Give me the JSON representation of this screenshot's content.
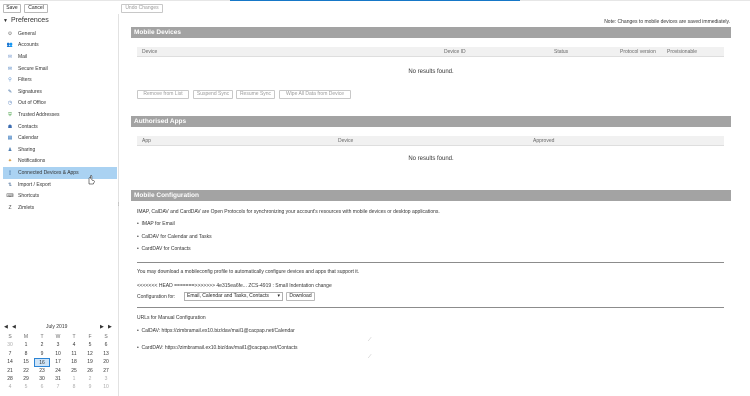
{
  "toolbar": {
    "save": "Save",
    "cancel": "Cancel",
    "undo": "Undo Changes"
  },
  "sidebar": {
    "title": "Preferences",
    "items": [
      {
        "label": "General",
        "icon": "gear-icon",
        "glyph": "⚙",
        "color": "#7a7a7a"
      },
      {
        "label": "Accounts",
        "icon": "accounts-icon",
        "glyph": "👥",
        "color": "#3b6fb0"
      },
      {
        "label": "Mail",
        "icon": "mail-icon",
        "glyph": "✉",
        "color": "#6b8fc8"
      },
      {
        "label": "Secure Email",
        "icon": "secure-email-icon",
        "glyph": "✉",
        "color": "#4a7fc0"
      },
      {
        "label": "Filters",
        "icon": "filters-icon",
        "glyph": "⚲",
        "color": "#5a8fcf"
      },
      {
        "label": "Signatures",
        "icon": "signature-icon",
        "glyph": "✎",
        "color": "#3a6aa0"
      },
      {
        "label": "Out of Office",
        "icon": "out-of-office-icon",
        "glyph": "◷",
        "color": "#4a78b8"
      },
      {
        "label": "Trusted Addresses",
        "icon": "shield-icon",
        "glyph": "⛨",
        "color": "#3a9a3a"
      },
      {
        "label": "Contacts",
        "icon": "contacts-icon",
        "glyph": "☗",
        "color": "#3c6cb0"
      },
      {
        "label": "Calendar",
        "icon": "calendar-icon",
        "glyph": "▦",
        "color": "#3c7cc0"
      },
      {
        "label": "Sharing",
        "icon": "sharing-icon",
        "glyph": "♟",
        "color": "#4c7cb0"
      },
      {
        "label": "Notifications",
        "icon": "notifications-icon",
        "glyph": "✦",
        "color": "#d08a20"
      },
      {
        "label": "Connected Devices & Apps",
        "icon": "devices-icon",
        "glyph": "▯",
        "color": "#3a6aa0",
        "selected": true
      },
      {
        "label": "Import / Export",
        "icon": "import-export-icon",
        "glyph": "⇅",
        "color": "#5a7aa0"
      },
      {
        "label": "Shortcuts",
        "icon": "shortcuts-icon",
        "glyph": "⌨",
        "color": "#555555"
      },
      {
        "label": "Zimlets",
        "icon": "zimlets-icon",
        "glyph": "Z",
        "color": "#444444"
      }
    ]
  },
  "calendar": {
    "prev": "◀",
    "prev_fast": "◀",
    "month": "July 2019",
    "next": "▶",
    "next_fast": "▶",
    "dow": [
      "S",
      "M",
      "T",
      "W",
      "T",
      "F",
      "S"
    ],
    "weeks": [
      [
        "30",
        "1",
        "2",
        "3",
        "4",
        "5",
        "6"
      ],
      [
        "7",
        "8",
        "9",
        "10",
        "11",
        "12",
        "13"
      ],
      [
        "14",
        "15",
        "16",
        "17",
        "18",
        "19",
        "20"
      ],
      [
        "21",
        "22",
        "23",
        "24",
        "25",
        "26",
        "27"
      ],
      [
        "28",
        "29",
        "30",
        "31",
        "1",
        "2",
        "3"
      ],
      [
        "4",
        "5",
        "6",
        "7",
        "8",
        "9",
        "10"
      ]
    ],
    "today": "16"
  },
  "main": {
    "note": "Note: Changes to mobile devices are saved immediately.",
    "mobile_devices": {
      "title": "Mobile Devices",
      "columns": [
        "Device",
        "Device ID",
        "Status",
        "Protocol version",
        "Provisionable"
      ],
      "empty": "No results found.",
      "buttons": [
        "Remove from List",
        "Suspend Sync",
        "Resume Sync",
        "Wipe All Data from Device"
      ]
    },
    "authorised_apps": {
      "title": "Authorised Apps",
      "columns": [
        "App",
        "Device",
        "Approved"
      ],
      "empty": "No results found."
    },
    "mobile_config": {
      "title": "Mobile Configuration",
      "intro": "IMAP, CalDAV and CardDAV are Open Protocols for synchronizing your account's resources with mobile devices or desktop applications.",
      "bullets": [
        "IMAP for Email",
        "CalDAV for Calendar and Tasks",
        "CardDAV for Contacts"
      ],
      "download_text": "You may download a mobileconfig profile to automatically configure devices and apps that support it.",
      "merge_text": "<<<<<<< HEAD =======>>>>>>> 4e315ea6fe... ZCS-4919 : Small Indentation change",
      "config_label": "Configuration for:",
      "config_value": "Email, Calendar and Tasks, Contacts",
      "download_button": "Download",
      "urls_title": "URLs for Manual Configuration",
      "caldav": "CalDAV: https://zimbramail.ex10.biz/dav/mail1@cacpap.net/Calendar",
      "carddav": "CardDAV: https://zimbramail.ex10.biz/dav/mail1@cacpap.net/Contacts"
    }
  }
}
